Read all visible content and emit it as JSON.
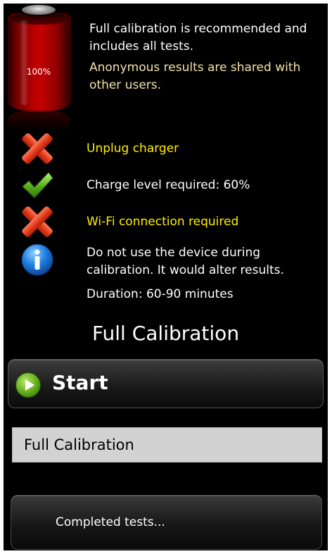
{
  "battery": {
    "level_label": "100%",
    "level": 1.0,
    "color": "#c40000"
  },
  "intro": {
    "line1": "Full calibration is recommended and includes all tests.",
    "line2": "Anonymous results are shared with other users."
  },
  "requirements": [
    {
      "icon": "cross-icon",
      "status": "fail",
      "text": "Unplug charger",
      "color": "#ffef00"
    },
    {
      "icon": "check-icon",
      "status": "ok",
      "text": "Charge level required:  60%",
      "color": "#ffffff"
    },
    {
      "icon": "cross-icon",
      "status": "fail",
      "text": "Wi-Fi connection required",
      "color": "#ffef00"
    },
    {
      "icon": "info-icon",
      "status": "info",
      "text": "Do not use the device during calibration. It would alter results.",
      "color": "#ffffff"
    }
  ],
  "duration": "Duration:  60-90  minutes",
  "section_title": "Full Calibration",
  "start_button": {
    "label": "Start",
    "icon": "play-icon"
  },
  "mode_select": {
    "value": "Full Calibration"
  },
  "completed_button": {
    "label": "Completed tests..."
  }
}
